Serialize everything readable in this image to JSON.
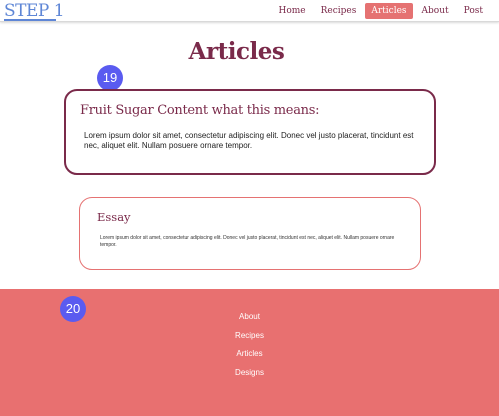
{
  "navbar": {
    "brand": "STEP 1",
    "links": [
      {
        "label": "Home",
        "active": false
      },
      {
        "label": "Recipes",
        "active": false
      },
      {
        "label": "Articles",
        "active": true
      },
      {
        "label": "About",
        "active": false
      },
      {
        "label": "Post",
        "active": false
      }
    ]
  },
  "page": {
    "title": "Articles"
  },
  "badges": {
    "first": "19",
    "second": "20"
  },
  "articles": [
    {
      "title": "Fruit Sugar Content what this means:",
      "body": "Lorem ipsum dolor sit amet, consectetur adipiscing elit. Donec vel justo  placerat, tincidunt est nec, aliquet elit. Nullam posuere ornare  tempor."
    },
    {
      "title": "Essay",
      "body": "Lorem ipsum dolor sit amet, consectetur adipiscing elit. Donec vel justo  placerat, tincidunt est nec, aliquet elit. Nullam posuere ornare  tempor."
    }
  ],
  "footer": {
    "links": [
      "About",
      "Recipes",
      "Articles",
      "Designs"
    ]
  },
  "colors": {
    "accent": "#e57272",
    "title": "#7a2a4a",
    "brand": "#5e86d6",
    "badge": "#5a5bf0"
  }
}
